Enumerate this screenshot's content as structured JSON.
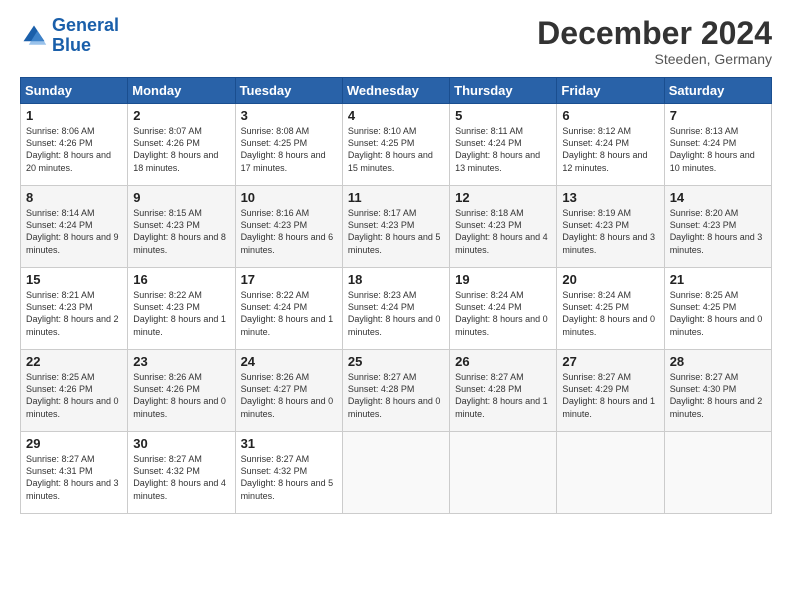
{
  "header": {
    "logo_line1": "General",
    "logo_line2": "Blue",
    "month": "December 2024",
    "location": "Steeden, Germany"
  },
  "weekdays": [
    "Sunday",
    "Monday",
    "Tuesday",
    "Wednesday",
    "Thursday",
    "Friday",
    "Saturday"
  ],
  "weeks": [
    [
      {
        "day": "1",
        "sunrise": "Sunrise: 8:06 AM",
        "sunset": "Sunset: 4:26 PM",
        "daylight": "Daylight: 8 hours and 20 minutes."
      },
      {
        "day": "2",
        "sunrise": "Sunrise: 8:07 AM",
        "sunset": "Sunset: 4:26 PM",
        "daylight": "Daylight: 8 hours and 18 minutes."
      },
      {
        "day": "3",
        "sunrise": "Sunrise: 8:08 AM",
        "sunset": "Sunset: 4:25 PM",
        "daylight": "Daylight: 8 hours and 17 minutes."
      },
      {
        "day": "4",
        "sunrise": "Sunrise: 8:10 AM",
        "sunset": "Sunset: 4:25 PM",
        "daylight": "Daylight: 8 hours and 15 minutes."
      },
      {
        "day": "5",
        "sunrise": "Sunrise: 8:11 AM",
        "sunset": "Sunset: 4:24 PM",
        "daylight": "Daylight: 8 hours and 13 minutes."
      },
      {
        "day": "6",
        "sunrise": "Sunrise: 8:12 AM",
        "sunset": "Sunset: 4:24 PM",
        "daylight": "Daylight: 8 hours and 12 minutes."
      },
      {
        "day": "7",
        "sunrise": "Sunrise: 8:13 AM",
        "sunset": "Sunset: 4:24 PM",
        "daylight": "Daylight: 8 hours and 10 minutes."
      }
    ],
    [
      {
        "day": "8",
        "sunrise": "Sunrise: 8:14 AM",
        "sunset": "Sunset: 4:24 PM",
        "daylight": "Daylight: 8 hours and 9 minutes."
      },
      {
        "day": "9",
        "sunrise": "Sunrise: 8:15 AM",
        "sunset": "Sunset: 4:23 PM",
        "daylight": "Daylight: 8 hours and 8 minutes."
      },
      {
        "day": "10",
        "sunrise": "Sunrise: 8:16 AM",
        "sunset": "Sunset: 4:23 PM",
        "daylight": "Daylight: 8 hours and 6 minutes."
      },
      {
        "day": "11",
        "sunrise": "Sunrise: 8:17 AM",
        "sunset": "Sunset: 4:23 PM",
        "daylight": "Daylight: 8 hours and 5 minutes."
      },
      {
        "day": "12",
        "sunrise": "Sunrise: 8:18 AM",
        "sunset": "Sunset: 4:23 PM",
        "daylight": "Daylight: 8 hours and 4 minutes."
      },
      {
        "day": "13",
        "sunrise": "Sunrise: 8:19 AM",
        "sunset": "Sunset: 4:23 PM",
        "daylight": "Daylight: 8 hours and 3 minutes."
      },
      {
        "day": "14",
        "sunrise": "Sunrise: 8:20 AM",
        "sunset": "Sunset: 4:23 PM",
        "daylight": "Daylight: 8 hours and 3 minutes."
      }
    ],
    [
      {
        "day": "15",
        "sunrise": "Sunrise: 8:21 AM",
        "sunset": "Sunset: 4:23 PM",
        "daylight": "Daylight: 8 hours and 2 minutes."
      },
      {
        "day": "16",
        "sunrise": "Sunrise: 8:22 AM",
        "sunset": "Sunset: 4:23 PM",
        "daylight": "Daylight: 8 hours and 1 minute."
      },
      {
        "day": "17",
        "sunrise": "Sunrise: 8:22 AM",
        "sunset": "Sunset: 4:24 PM",
        "daylight": "Daylight: 8 hours and 1 minute."
      },
      {
        "day": "18",
        "sunrise": "Sunrise: 8:23 AM",
        "sunset": "Sunset: 4:24 PM",
        "daylight": "Daylight: 8 hours and 0 minutes."
      },
      {
        "day": "19",
        "sunrise": "Sunrise: 8:24 AM",
        "sunset": "Sunset: 4:24 PM",
        "daylight": "Daylight: 8 hours and 0 minutes."
      },
      {
        "day": "20",
        "sunrise": "Sunrise: 8:24 AM",
        "sunset": "Sunset: 4:25 PM",
        "daylight": "Daylight: 8 hours and 0 minutes."
      },
      {
        "day": "21",
        "sunrise": "Sunrise: 8:25 AM",
        "sunset": "Sunset: 4:25 PM",
        "daylight": "Daylight: 8 hours and 0 minutes."
      }
    ],
    [
      {
        "day": "22",
        "sunrise": "Sunrise: 8:25 AM",
        "sunset": "Sunset: 4:26 PM",
        "daylight": "Daylight: 8 hours and 0 minutes."
      },
      {
        "day": "23",
        "sunrise": "Sunrise: 8:26 AM",
        "sunset": "Sunset: 4:26 PM",
        "daylight": "Daylight: 8 hours and 0 minutes."
      },
      {
        "day": "24",
        "sunrise": "Sunrise: 8:26 AM",
        "sunset": "Sunset: 4:27 PM",
        "daylight": "Daylight: 8 hours and 0 minutes."
      },
      {
        "day": "25",
        "sunrise": "Sunrise: 8:27 AM",
        "sunset": "Sunset: 4:28 PM",
        "daylight": "Daylight: 8 hours and 0 minutes."
      },
      {
        "day": "26",
        "sunrise": "Sunrise: 8:27 AM",
        "sunset": "Sunset: 4:28 PM",
        "daylight": "Daylight: 8 hours and 1 minute."
      },
      {
        "day": "27",
        "sunrise": "Sunrise: 8:27 AM",
        "sunset": "Sunset: 4:29 PM",
        "daylight": "Daylight: 8 hours and 1 minute."
      },
      {
        "day": "28",
        "sunrise": "Sunrise: 8:27 AM",
        "sunset": "Sunset: 4:30 PM",
        "daylight": "Daylight: 8 hours and 2 minutes."
      }
    ],
    [
      {
        "day": "29",
        "sunrise": "Sunrise: 8:27 AM",
        "sunset": "Sunset: 4:31 PM",
        "daylight": "Daylight: 8 hours and 3 minutes."
      },
      {
        "day": "30",
        "sunrise": "Sunrise: 8:27 AM",
        "sunset": "Sunset: 4:32 PM",
        "daylight": "Daylight: 8 hours and 4 minutes."
      },
      {
        "day": "31",
        "sunrise": "Sunrise: 8:27 AM",
        "sunset": "Sunset: 4:32 PM",
        "daylight": "Daylight: 8 hours and 5 minutes."
      },
      null,
      null,
      null,
      null
    ]
  ]
}
